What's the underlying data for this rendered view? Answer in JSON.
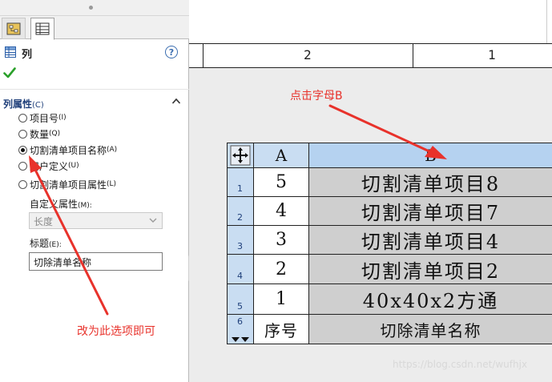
{
  "panel": {
    "title": "列",
    "help": "?",
    "section_title": "列属性",
    "section_shortcut": "(C)",
    "options": [
      {
        "label": "项目号",
        "shortcut": "(I)",
        "selected": false
      },
      {
        "label": "数量",
        "shortcut": "(Q)",
        "selected": false
      },
      {
        "label": "切割清单项目名称",
        "shortcut": "(A)",
        "selected": true
      },
      {
        "label": "用户定义",
        "shortcut": "(U)",
        "selected": false
      },
      {
        "label": "切割清单项目属性",
        "shortcut": "(L)",
        "selected": false
      }
    ],
    "custom_property_label": "自定义属性",
    "custom_property_shortcut": "(M):",
    "custom_property_value": "长度",
    "title_field_label": "标题",
    "title_field_shortcut": "(E):",
    "title_field_value": "切除清单名称"
  },
  "sheet": {
    "zones": [
      "2",
      "1"
    ]
  },
  "bom": {
    "columns": [
      "A",
      "B"
    ],
    "rows": [
      {
        "num": "1",
        "a": "5",
        "b": "切割清单项目8"
      },
      {
        "num": "2",
        "a": "4",
        "b": "切割清单项目7"
      },
      {
        "num": "3",
        "a": "3",
        "b": "切割清单项目4"
      },
      {
        "num": "4",
        "a": "2",
        "b": "切割清单项目2"
      },
      {
        "num": "5",
        "a": "1",
        "b": "40x40x2方通"
      },
      {
        "num": "6",
        "a": "序号",
        "b": "切除清单名称"
      }
    ]
  },
  "annotations": {
    "click_b": "点击字母B",
    "change_option": "改为此选项即可"
  },
  "watermark": "https://blog.csdn.net/wufhjx",
  "colors": {
    "annotation": "#e8322b",
    "header_blue": "#c9ddf2",
    "selected_cell": "#cfcfcf"
  }
}
